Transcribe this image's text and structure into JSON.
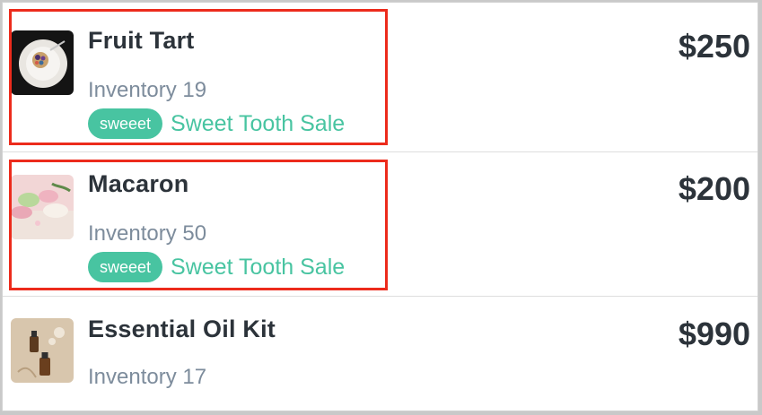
{
  "products": [
    {
      "name": "Fruit Tart",
      "inventory": "Inventory 19",
      "price": "$250",
      "tag": {
        "pill": "sweeet",
        "label": "Sweet Tooth Sale"
      },
      "thumbnail_icon": "fruit-tart-photo"
    },
    {
      "name": "Macaron",
      "inventory": "Inventory 50",
      "price": "$200",
      "tag": {
        "pill": "sweeet",
        "label": "Sweet Tooth Sale"
      },
      "thumbnail_icon": "macaron-photo"
    },
    {
      "name": "Essential Oil Kit",
      "inventory": "Inventory 17",
      "price": "$990",
      "thumbnail_icon": "essential-oil-photo"
    }
  ],
  "colors": {
    "accent": "#48c4a1",
    "highlight": "#ec2b1c",
    "title": "#2c333a",
    "muted": "#7d8c9c"
  }
}
